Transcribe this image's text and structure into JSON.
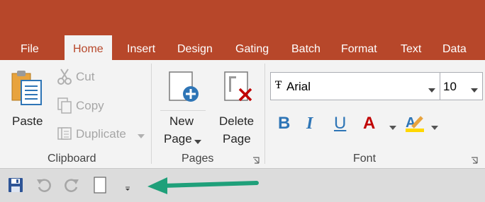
{
  "tabs": [
    {
      "label": "File"
    },
    {
      "label": "Home"
    },
    {
      "label": "Insert"
    },
    {
      "label": "Design"
    },
    {
      "label": "Gating"
    },
    {
      "label": "Batch"
    },
    {
      "label": "Format"
    },
    {
      "label": "Text"
    },
    {
      "label": "Data"
    }
  ],
  "clipboard": {
    "paste": "Paste",
    "cut": "Cut",
    "copy": "Copy",
    "duplicate": "Duplicate",
    "label": "Clipboard"
  },
  "pages": {
    "new_line1": "New",
    "new_line2": "Page",
    "delete_line1": "Delete",
    "delete_line2": "Page",
    "label": "Pages"
  },
  "font": {
    "name": "Arial",
    "size": "10",
    "bold": "B",
    "italic": "I",
    "underline": "U",
    "color_letter": "A",
    "label": "Font"
  },
  "colors": {
    "brand": "#b7472a",
    "format_blue": "#2e75b6",
    "font_color_red": "#c00000",
    "highlight_yellow": "#ffd700",
    "arrow_green": "#1fa07a"
  }
}
